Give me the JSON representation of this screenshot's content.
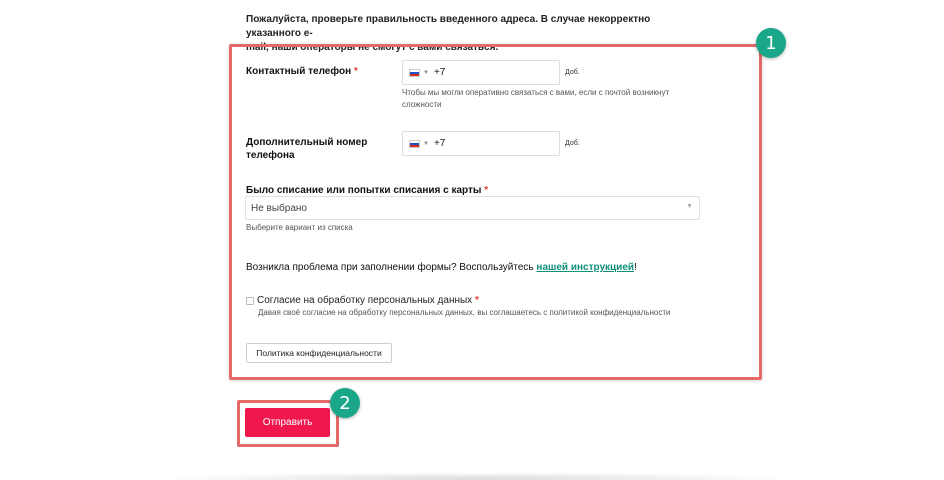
{
  "notice": {
    "line1": "Пожалуйста, проверьте правильность введенного адреса. В случае некорректно указанного e-",
    "line2": "mail, наши операторы не смогут с вами связаться."
  },
  "badges": {
    "one": "1",
    "two": "2"
  },
  "phone_main": {
    "label": "Контактный телефон",
    "required_mark": "*",
    "prefix": "+7",
    "ext_label": "Доб.",
    "hint_line1": "Чтобы мы могли оперативно связаться с вами, если с почтой возникнут",
    "hint_line2": "сложности"
  },
  "phone_extra": {
    "label_line1": "Дополнительный номер",
    "label_line2": "телефона",
    "prefix": "+7",
    "ext_label": "Доб."
  },
  "card_charge": {
    "label": "Было списание или попытки списания с карты",
    "required_mark": "*",
    "selected": "Не выбрано",
    "hint": "Выберите вариант из списка"
  },
  "help": {
    "text": "Возникла проблема при заполнении формы? Воспользуйтесь ",
    "link": "нашей инструкцией",
    "end": "!"
  },
  "consent": {
    "label": "Согласие на обработку персональных данных",
    "required_mark": "*",
    "description": "Давая своё согласие на обработку персональных данных, вы соглашаетесь с политикой конфиденциальности"
  },
  "policy_button": "Политика конфиденциальности",
  "submit_button": "Отправить",
  "colors": {
    "accent": "#f0164e",
    "badge": "#1aa789",
    "highlight_frame": "#e46a6a",
    "link": "#0d8f7a"
  },
  "icons": {
    "flag": "russia-flag-icon",
    "caret": "chevron-down-icon"
  }
}
